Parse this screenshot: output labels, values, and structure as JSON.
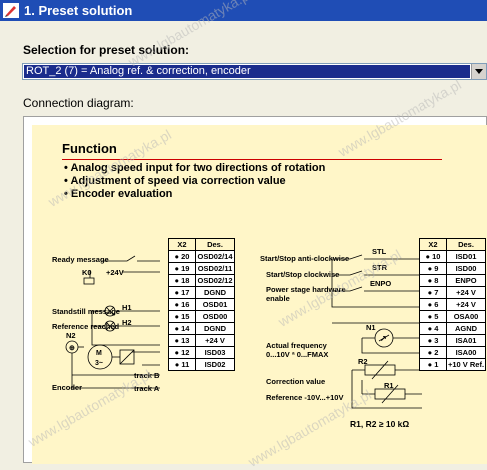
{
  "window": {
    "title": "1. Preset solution"
  },
  "selection": {
    "label": "Selection for preset solution:",
    "value": "ROT_2 (7) = Analog ref. & correction, encoder"
  },
  "connection_label": "Connection diagram:",
  "function": {
    "title": "Function",
    "bullets": [
      "• Analog speed input for two directions of rotation",
      "• Adjustment of speed via correction value",
      "• Encoder evaluation"
    ]
  },
  "left_terminal": {
    "headers": [
      "X2",
      "Des."
    ],
    "rows": [
      {
        "pin": "20",
        "des": "OSD02/14"
      },
      {
        "pin": "19",
        "des": "OSD02/11"
      },
      {
        "pin": "18",
        "des": "OSD02/12"
      },
      {
        "pin": "17",
        "des": "DGND"
      },
      {
        "pin": "16",
        "des": "OSD01"
      },
      {
        "pin": "15",
        "des": "OSD00"
      },
      {
        "pin": "14",
        "des": "DGND"
      },
      {
        "pin": "13",
        "des": "+24 V"
      },
      {
        "pin": "12",
        "des": "ISD03"
      },
      {
        "pin": "11",
        "des": "ISD02"
      }
    ]
  },
  "right_terminal": {
    "headers": [
      "X2",
      "Des."
    ],
    "rows": [
      {
        "pin": "10",
        "des": "ISD01"
      },
      {
        "pin": "9",
        "des": "ISD00"
      },
      {
        "pin": "8",
        "des": "ENPO"
      },
      {
        "pin": "7",
        "des": "+24 V"
      },
      {
        "pin": "6",
        "des": "+24 V"
      },
      {
        "pin": "5",
        "des": "OSA00"
      },
      {
        "pin": "4",
        "des": "AGND"
      },
      {
        "pin": "3",
        "des": "ISA01"
      },
      {
        "pin": "2",
        "des": "ISA00"
      },
      {
        "pin": "1",
        "des": "+10 V Ref."
      }
    ]
  },
  "left_labels": {
    "ready": "Ready message",
    "k0": "K0",
    "plus24": "+24V",
    "standstill": "Standstill message",
    "ref_reached": "Reference reached",
    "h1": "H1",
    "h2": "H2",
    "n2": "N2",
    "motor_m": "M",
    "motor_3": "3~",
    "encoder": "Encoder",
    "track_b": "track B",
    "track_a": "track A"
  },
  "right_labels": {
    "stl_desc": "Start/Stop anti-clockwise",
    "str_desc": "Start/Stop clockwise",
    "enpo_desc_1": "Power stage hardware",
    "enpo_desc_2": "enable",
    "stl": "STL",
    "str": "STR",
    "enpo": "ENPO",
    "n1": "N1",
    "actual_freq_1": "Actual frequency",
    "actual_freq_2": "0...10V ª 0...FMAX",
    "correction": "Correction value",
    "reference": "Reference -10V...+10V",
    "r2": "R2",
    "r1": "R1",
    "resistor_note": "R1, R2 ≥ 10 kΩ"
  },
  "watermark": "www.lgbautomatyka.pl",
  "colors": {
    "title_bar": "#1f4db5",
    "selection_highlight": "#1a2c8c",
    "diagram_bg": "#fff6c8",
    "rule": "#cc0000"
  }
}
